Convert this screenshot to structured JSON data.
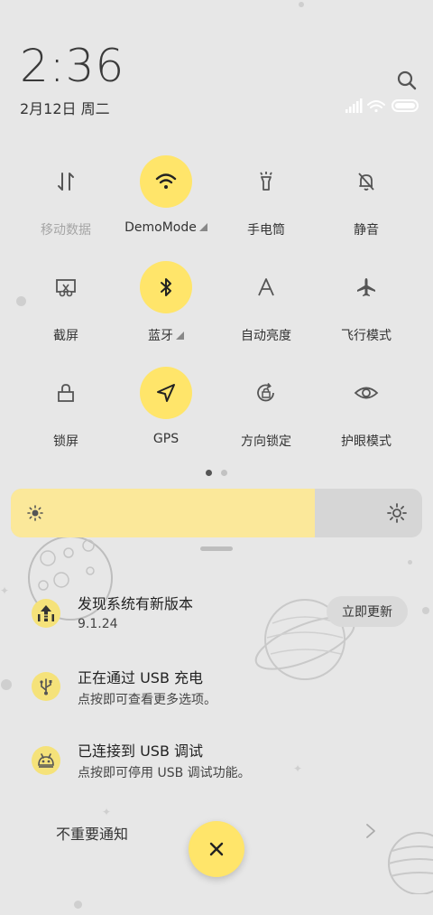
{
  "header": {
    "time": "2:36",
    "date": "2月12日 周二"
  },
  "toggles": [
    {
      "label": "移动数据",
      "icon": "mobile-data-icon",
      "active": false
    },
    {
      "label": "DemoMode",
      "icon": "wifi-icon",
      "active": true
    },
    {
      "label": "手电筒",
      "icon": "flashlight-icon",
      "active": false
    },
    {
      "label": "静音",
      "icon": "mute-bell-icon",
      "active": false
    },
    {
      "label": "截屏",
      "icon": "screenshot-icon",
      "active": false
    },
    {
      "label": "蓝牙",
      "icon": "bluetooth-icon",
      "active": true
    },
    {
      "label": "自动亮度",
      "icon": "auto-brightness-icon",
      "active": false
    },
    {
      "label": "飞行模式",
      "icon": "airplane-icon",
      "active": false
    },
    {
      "label": "锁屏",
      "icon": "lock-icon",
      "active": false
    },
    {
      "label": "GPS",
      "icon": "location-arrow-icon",
      "active": true
    },
    {
      "label": "方向锁定",
      "icon": "rotation-lock-icon",
      "active": false
    },
    {
      "label": "护眼模式",
      "icon": "eye-icon",
      "active": false
    }
  ],
  "pager": {
    "pages": 2,
    "current": 1
  },
  "brightness": {
    "level": 0.74
  },
  "notifications": [
    {
      "title": "发现系统有新版本",
      "subtitle": "9.1.24",
      "action": "立即更新",
      "icon": "system-update-icon"
    },
    {
      "title": "正在通过 USB 充电",
      "subtitle": "点按即可查看更多选项。",
      "icon": "usb-icon"
    },
    {
      "title": "已连接到 USB 调试",
      "subtitle": "点按即可停用 USB 调试功能。",
      "icon": "android-debug-icon"
    }
  ],
  "minor_notifications": {
    "label": "不重要通知"
  },
  "colors": {
    "accent": "#ffe56a",
    "background": "#e7e7e7",
    "brightness_fill": "#fbe89a"
  }
}
